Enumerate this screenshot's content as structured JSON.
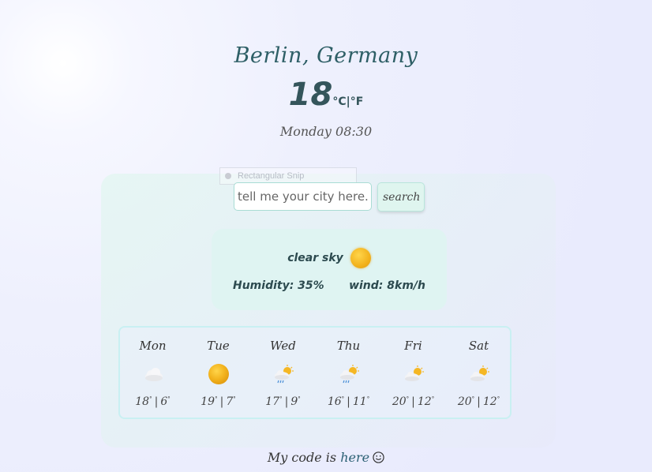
{
  "location": {
    "city": "Berlin, Germany"
  },
  "current": {
    "temperature": "18",
    "unit_c": "°C",
    "unit_sep": "|",
    "unit_f": "°F",
    "datetime": "Monday 08:30",
    "description": "clear sky",
    "icon": "sun-icon",
    "humidity": "Humidity: 35%",
    "wind": "wind: 8km/h"
  },
  "overlay": {
    "snip_label": "Rectangular Snip"
  },
  "search": {
    "placeholder": "tell me your city here..",
    "value": "",
    "button_label": "search"
  },
  "forecast": [
    {
      "day": "Mon",
      "icon": "cloud-icon",
      "max": "18",
      "min": "6"
    },
    {
      "day": "Tue",
      "icon": "sun-icon",
      "max": "19",
      "min": "7"
    },
    {
      "day": "Wed",
      "icon": "sun-cloud-rain-icon",
      "max": "17",
      "min": "9"
    },
    {
      "day": "Thu",
      "icon": "sun-cloud-rain-icon",
      "max": "16",
      "min": "11"
    },
    {
      "day": "Fri",
      "icon": "sun-cloud-icon",
      "max": "20",
      "min": "12"
    },
    {
      "day": "Sat",
      "icon": "sun-cloud-icon",
      "max": "20",
      "min": "12"
    }
  ],
  "degree_symbol": "°",
  "temp_separator": "|",
  "footer": {
    "prefix": "My code is",
    "link": "here"
  },
  "colors": {
    "accent": "#2e5f66",
    "panel": "#dff4f2",
    "sun": "#f2b21c"
  }
}
